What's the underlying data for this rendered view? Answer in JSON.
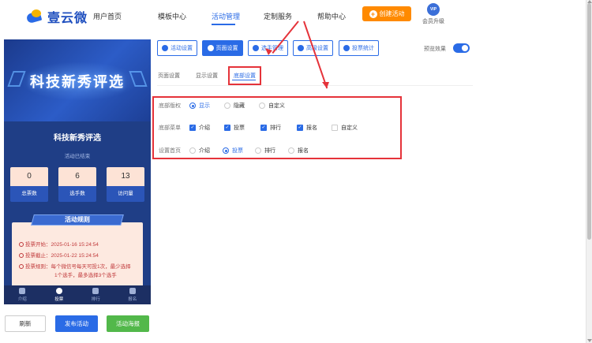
{
  "app": {
    "brand": "壹云微"
  },
  "nav": {
    "items": [
      "用户首页",
      "模板中心",
      "活动管理",
      "定制服务",
      "帮助中心"
    ],
    "active": "活动管理",
    "create_label": "创建活动",
    "vip_badge": "VIP",
    "vip_label": "会员升级"
  },
  "preview": {
    "banner_title": "科技新秀评选",
    "activity_title": "科技新秀评选",
    "status": "活动已结束",
    "stats": [
      {
        "value": "0",
        "label": "总票数"
      },
      {
        "value": "6",
        "label": "选手数"
      },
      {
        "value": "13",
        "label": "访问量"
      }
    ],
    "rules_title": "活动规则",
    "rules": [
      "投票开始：2025-01-16 15:24:54",
      "投票截止：2025-01-22 15:24:54",
      "投票规则：每个微信号每天可投1次，最少选择",
      "1个选手，最多选择3个选手"
    ],
    "tabs": [
      "介绍",
      "投票",
      "排行",
      "报名"
    ],
    "active_tab": "投票"
  },
  "actions": {
    "refresh": "刷新",
    "publish": "发布活动",
    "poster": "活动海报"
  },
  "toolbar": {
    "buttons": [
      "活动设置",
      "页面设置",
      "选手管理",
      "高级设置",
      "投票统计"
    ],
    "active": "页面设置",
    "preview_label": "预览效果",
    "preview_on": true
  },
  "subtabs": {
    "items": [
      "页面设置",
      "显示设置",
      "底部设置"
    ],
    "active": "底部设置"
  },
  "form": {
    "copyright": {
      "label": "底部版权",
      "options": [
        "显示",
        "隐藏",
        "自定义"
      ],
      "selected": "显示"
    },
    "menu": {
      "label": "底部菜单",
      "options": [
        "介绍",
        "投票",
        "排行",
        "报名",
        "自定义"
      ],
      "checked": [
        "介绍",
        "投票",
        "排行",
        "报名"
      ]
    },
    "home": {
      "label": "设置首页",
      "options": [
        "介绍",
        "投票",
        "排行",
        "报名"
      ],
      "selected": "投票"
    }
  },
  "colors": {
    "accent": "#2a6be6",
    "create": "#ff8a00",
    "publish": "#2a6be6",
    "poster": "#52b84a",
    "highlight": "#e5333a"
  }
}
